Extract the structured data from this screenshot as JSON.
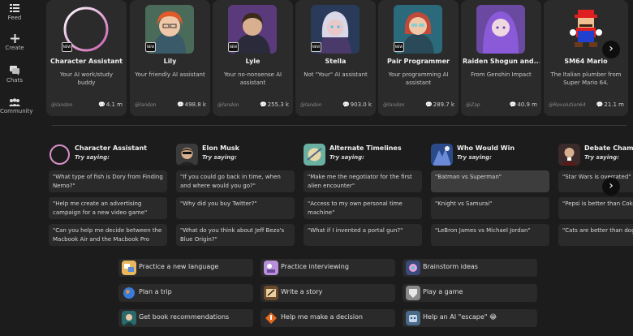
{
  "sidebar": {
    "items": [
      {
        "label": "Feed"
      },
      {
        "label": "Create"
      },
      {
        "label": "Chats"
      },
      {
        "label": "Community"
      }
    ]
  },
  "cards": [
    {
      "name": "Character Assistant",
      "description": "Your AI work/study buddy",
      "author": "@landon",
      "count": "4.1 m",
      "new": true
    },
    {
      "name": "Lily",
      "description": "Your friendly AI assistant",
      "author": "@landon",
      "count": "498.8 k",
      "new": true
    },
    {
      "name": "Lyle",
      "description": "Your no-nonsense AI assistant",
      "author": "@landon",
      "count": "255.3 k",
      "new": true
    },
    {
      "name": "Stella",
      "description": "Not \"Your\" AI assistant",
      "author": "@landon",
      "count": "903.0 k",
      "new": true
    },
    {
      "name": "Pair Programmer",
      "description": "Your programming AI assistant",
      "author": "@landon",
      "count": "289.7 k",
      "new": true
    },
    {
      "name": "Raiden Shogun and...",
      "description": "From Genshin Impact",
      "author": "@Zap",
      "count": "40.9 m",
      "new": false
    },
    {
      "name": "SM64 Mario",
      "description": "The Italian plumber from Super Mario 64.",
      "author": "@Revolution64",
      "count": "21.1 m",
      "new": false
    }
  ],
  "next_arrow": "›",
  "try_saying": "Try saying:",
  "columns": [
    {
      "title": "Character Assistant",
      "suggestions": [
        "\"What type of fish is Dory from Finding Nemo?\"",
        "\"Help me create an advertising campaign for a new video game\"",
        "\"Can you help me decide between the Macbook Air and the Macbook Pro 16?\""
      ]
    },
    {
      "title": "Elon Musk",
      "suggestions": [
        "\"If you could go back in time, when and where would you go?\"",
        "\"Why did you buy Twitter?\"",
        "\"What do you think about Jeff Bezo's Blue Origin?\""
      ]
    },
    {
      "title": "Alternate Timelines",
      "suggestions": [
        "\"Make me the negotiator for the first alien encounter\"",
        "\"Access to my own personal time machine\"",
        "\"What if I invented a portal gun?\""
      ]
    },
    {
      "title": "Who Would Win",
      "suggestions": [
        "\"Batman vs Superman\"",
        "\"Knight vs Samurai\"",
        "\"LeBron James vs Michael Jordan\""
      ]
    },
    {
      "title": "Debate Champion",
      "suggestions": [
        "\"Star Wars is overrated\"",
        "\"Pepsi is better than Coke\"",
        "\"Cats are better than dogs\""
      ]
    }
  ],
  "quick_actions": [
    {
      "label": "Practice a new language"
    },
    {
      "label": "Practice interviewing"
    },
    {
      "label": "Brainstorm ideas"
    },
    {
      "label": "Plan a trip"
    },
    {
      "label": "Write a story"
    },
    {
      "label": "Play a game"
    },
    {
      "label": "Get book recommendations"
    },
    {
      "label": "Help me make a decision"
    },
    {
      "label": "Help an AI \"escape\" 😂"
    }
  ],
  "colors": {
    "background": "#1c1c1c",
    "card": "#2b2b2b",
    "suggestion": "#2a2a2a",
    "ring_gradient": [
      "#c85cb0",
      "#ffffff"
    ]
  }
}
